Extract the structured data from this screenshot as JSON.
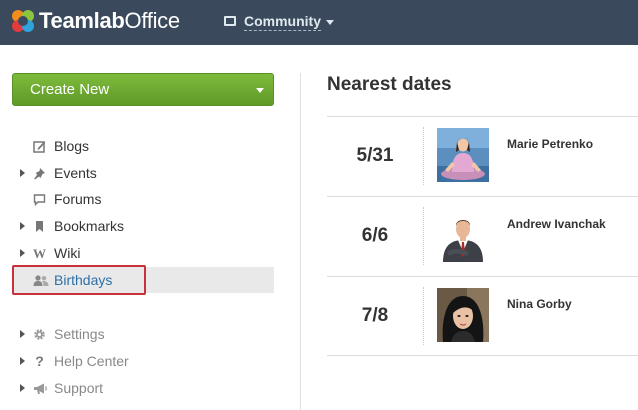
{
  "header": {
    "logo_bold": "Teamlab",
    "logo_regular": "Office",
    "module_label": "Community"
  },
  "sidebar": {
    "create_label": "Create New",
    "items": [
      {
        "label": "Blogs",
        "icon": "pencil-square-icon",
        "expandable": false
      },
      {
        "label": "Events",
        "icon": "pin-icon",
        "expandable": true
      },
      {
        "label": "Forums",
        "icon": "speech-bubble-icon",
        "expandable": false
      },
      {
        "label": "Bookmarks",
        "icon": "bookmark-icon",
        "expandable": true
      },
      {
        "label": "Wiki",
        "icon": "wiki-w-icon",
        "expandable": true
      },
      {
        "label": "Birthdays",
        "icon": "users-icon",
        "expandable": false,
        "active": true
      }
    ],
    "secondary": [
      {
        "label": "Settings",
        "icon": "gear-icon",
        "expandable": true
      },
      {
        "label": "Help Center",
        "icon": "question-icon",
        "expandable": true
      },
      {
        "label": "Support",
        "icon": "megaphone-icon",
        "expandable": true
      }
    ]
  },
  "main": {
    "title": "Nearest dates",
    "birthdays": [
      {
        "date": "5/31",
        "name": "Marie Petrenko"
      },
      {
        "date": "6/6",
        "name": "Andrew Ivanchak"
      },
      {
        "date": "7/8",
        "name": "Nina Gorby"
      }
    ]
  },
  "colors": {
    "topbar": "#3a4a5c",
    "create_button": "#6aa82f",
    "active_link": "#2f6fa7",
    "highlight_border": "#c8313a"
  }
}
